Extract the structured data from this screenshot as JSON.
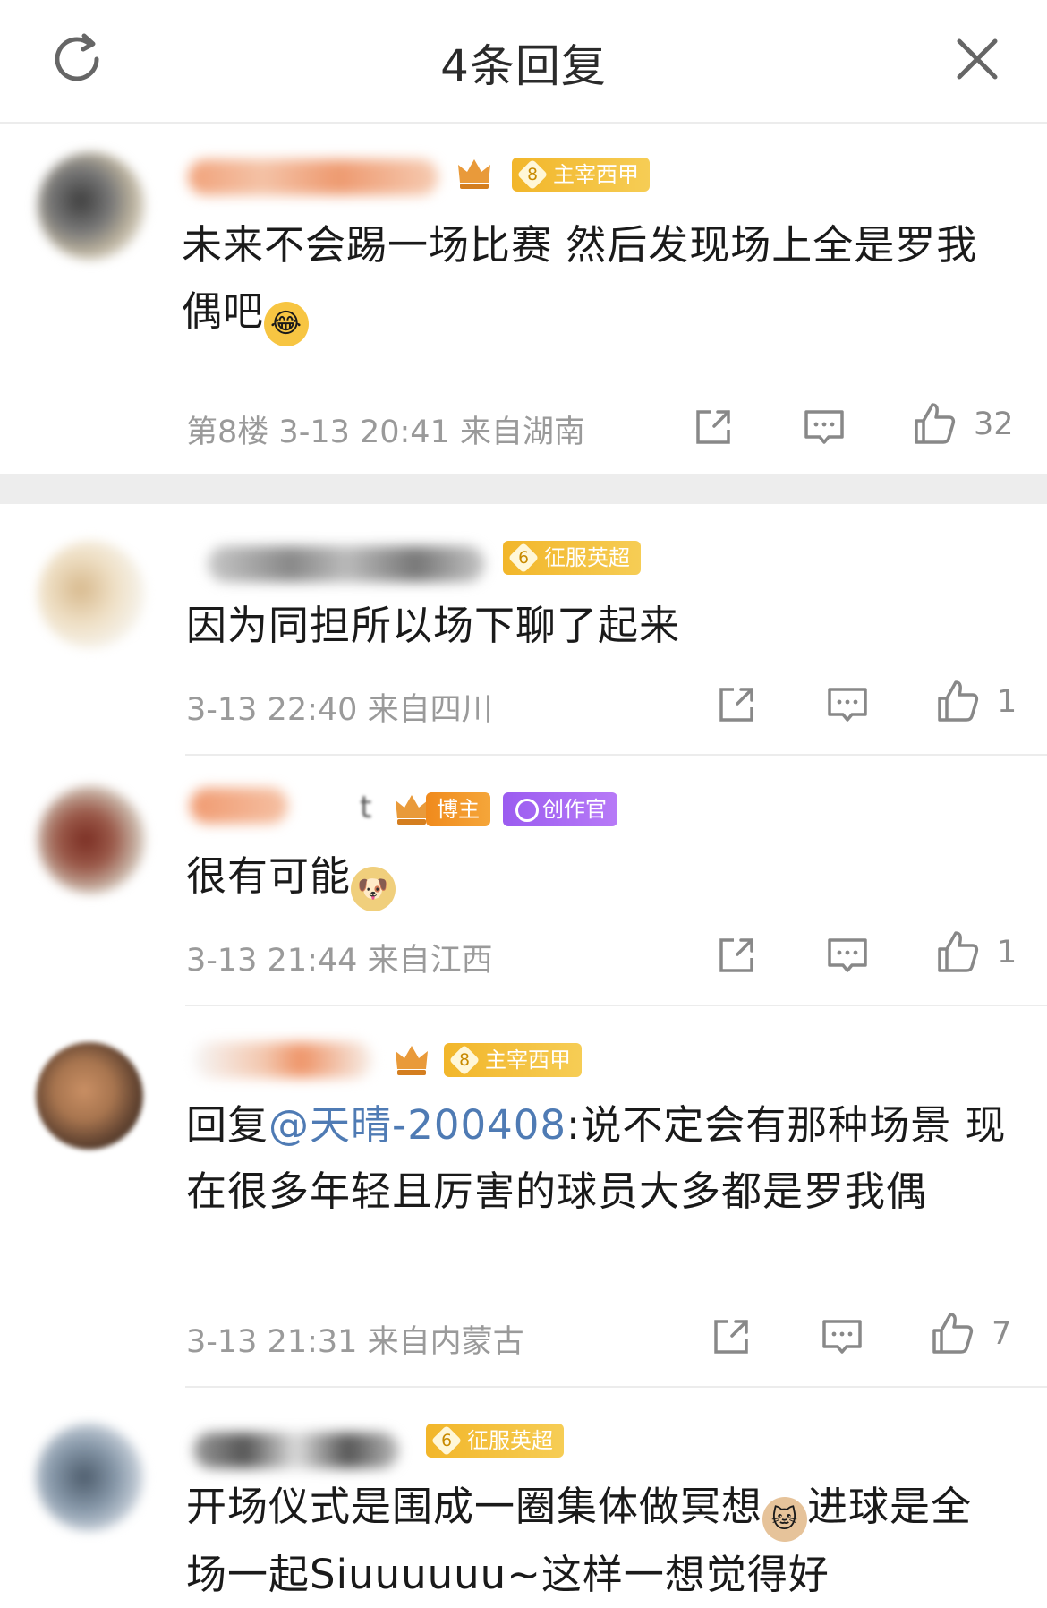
{
  "header": {
    "title": "4条回复",
    "refresh_icon": "refresh-icon",
    "close_icon": "close-icon"
  },
  "comments": [
    {
      "badges": [
        {
          "level": "8",
          "label": "主宰西甲",
          "style": "gold"
        }
      ],
      "text": "未来不会踢一场比赛 然后发现场上全是罗我偶吧",
      "emoji": "laughing-tears-emoji",
      "floor": "第8楼",
      "time": "3-13 20:41",
      "location": "来自湖南",
      "likes": "32"
    },
    {
      "badges": [
        {
          "level": "6",
          "label": "征服英超",
          "style": "gold"
        }
      ],
      "text": "因为同担所以场下聊了起来",
      "time": "3-13 22:40",
      "location": "来自四川",
      "likes": "1"
    },
    {
      "name_tail": "t",
      "badges": [
        {
          "label": "博主",
          "style": "orange"
        },
        {
          "label": "创作官",
          "style": "purple"
        }
      ],
      "text": "很有可能",
      "emoji": "doge-emoji",
      "time": "3-13 21:44",
      "location": "来自江西",
      "likes": "1"
    },
    {
      "badges": [
        {
          "level": "8",
          "label": "主宰西甲",
          "style": "gold"
        }
      ],
      "reply_prefix": "回复",
      "mention": "@天晴-200408",
      "text": ":说不定会有那种场景 现在很多年轻且厉害的球员大多都是罗我偶",
      "time": "3-13 21:31",
      "location": "来自内蒙古",
      "likes": "7"
    },
    {
      "badges": [
        {
          "level": "6",
          "label": "征服英超",
          "style": "gold"
        }
      ],
      "text_before": "开场仪式是围成一圈集体做冥想",
      "emoji": "cat-emoji",
      "text_after": "进球是全场一起Siuuuuuu~这样一想觉得好"
    }
  ],
  "colors": {
    "accent_link": "#4f7bb4",
    "badge_gold": "#f2b62a",
    "badge_orange": "#f08a1c",
    "badge_purple": "#9b5cf0",
    "meta_gray": "#9a9a9a"
  }
}
